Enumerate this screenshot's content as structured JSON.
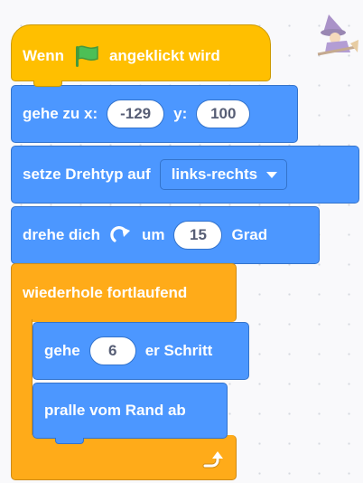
{
  "event_block": {
    "label_before": "Wenn",
    "flag_icon": "green-flag-icon",
    "label_after": "angeklickt wird"
  },
  "goto_block": {
    "label_x": "gehe zu x:",
    "x_value": "-129",
    "label_y": "y:",
    "y_value": "100"
  },
  "rotation_block": {
    "label": "setze Drehtyp auf",
    "dropdown_value": "links-rechts"
  },
  "turn_block": {
    "label_before": "drehe dich",
    "icon": "rotate-clockwise-icon",
    "label_um": "um",
    "degrees": "15",
    "label_after": "Grad"
  },
  "forever_block": {
    "label": "wiederhole fortlaufend",
    "icon": "loop-arrow-icon"
  },
  "move_block": {
    "label_before": "gehe",
    "steps": "6",
    "label_after": "er Schritt"
  },
  "bounce_block": {
    "label": "pralle vom Rand ab"
  },
  "sprite": {
    "icon": "witch-sprite-icon"
  },
  "colors": {
    "motion": "#4c97ff",
    "event": "#ffbf00",
    "control": "#ffab19",
    "flag": "#4cbf56"
  }
}
